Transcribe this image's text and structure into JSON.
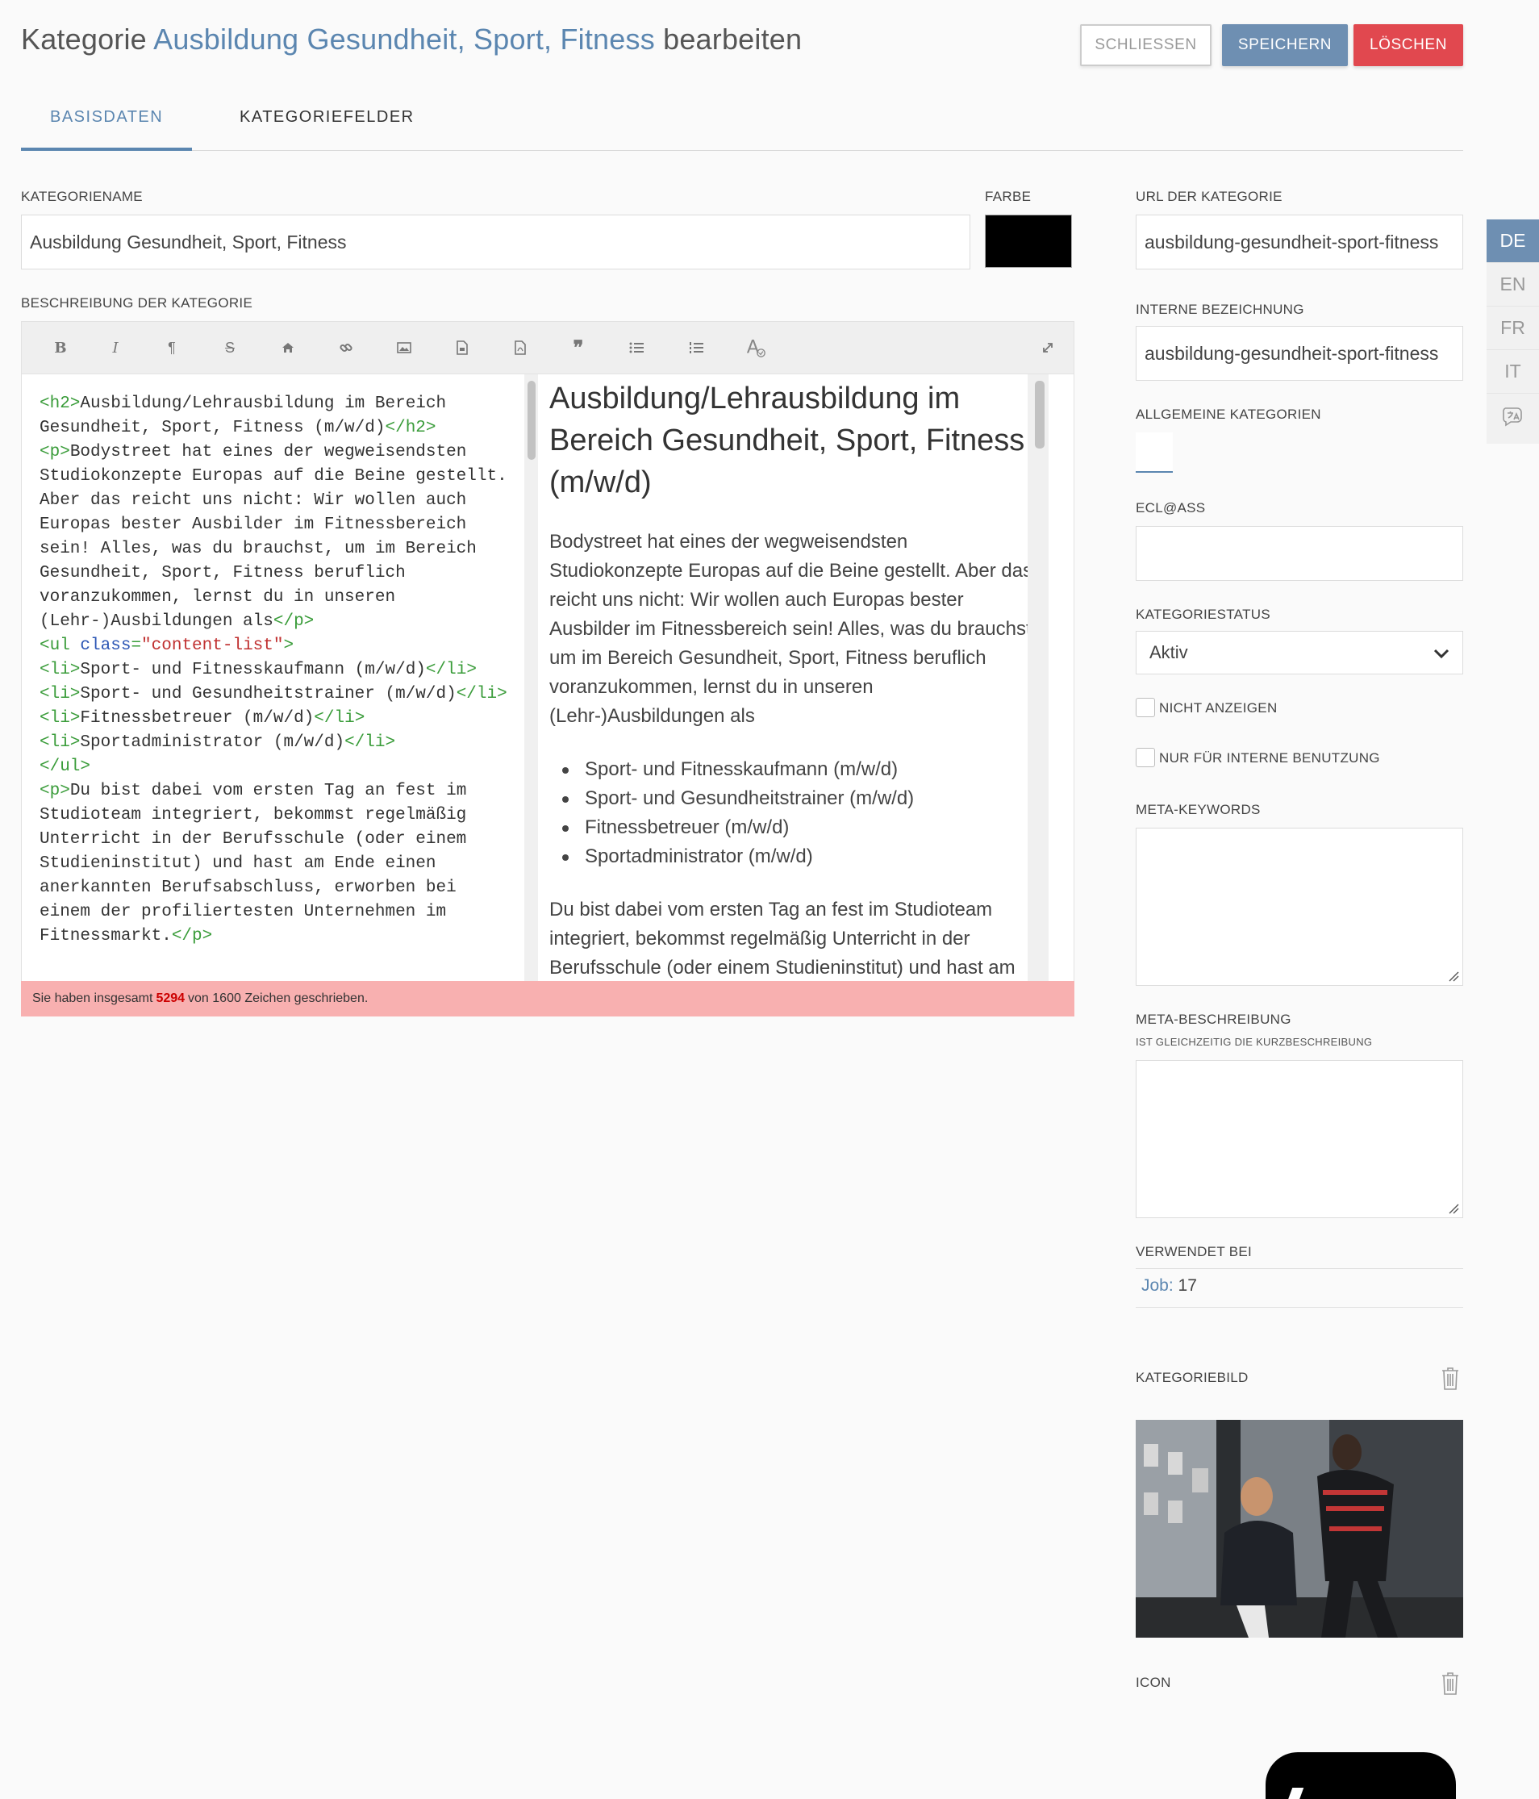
{
  "header": {
    "title_prefix": "Kategorie",
    "title_category": "Ausbildung Gesundheit, Sport, Fitness",
    "title_suffix": "bearbeiten",
    "close_label": "SCHLIESSEN",
    "save_label": "SPEICHERN",
    "delete_label": "LÖSCHEN"
  },
  "tabs": [
    {
      "label": "BASISDATEN",
      "active": true
    },
    {
      "label": "KATEGORIEFELDER",
      "active": false
    }
  ],
  "form": {
    "name_label": "KATEGORIENAME",
    "name_value": "Ausbildung Gesundheit, Sport, Fitness",
    "color_label": "FARBE",
    "color_value": "#000000",
    "description_label": "BESCHREIBUNG DER KATEGORIE",
    "toolbar_icons": [
      "bold-icon",
      "italic-icon",
      "paragraph-icon",
      "strikethrough-icon",
      "home-icon",
      "link-icon",
      "image-icon",
      "file-icon",
      "pdf-icon",
      "quote-icon",
      "unordered-list-icon",
      "ordered-list-icon",
      "spellcheck-icon",
      "fullscreen-icon"
    ],
    "status_prefix": "Sie haben insgesamt",
    "status_count": "5294",
    "status_suffix": "von 1600 Zeichen geschrieben."
  },
  "preview": {
    "heading": "Ausbildung/Lehrausbildung im Bereich Gesundheit, Sport, Fitness (m/w/d)",
    "paragraph1": "Bodystreet hat eines der wegweisendsten Studiokonzepte Europas auf die Beine gestellt. Aber das reicht uns nicht: Wir wollen auch Europas bester Ausbilder im Fitnessbereich sein! Alles, was du brauchst, um im Bereich Gesundheit, Sport, Fitness beruflich voranzukommen, lernst du in unseren (Lehr-)Ausbildungen als",
    "list": [
      "Sport- und Fitnesskaufmann (m/w/d)",
      "Sport- und Gesundheitstrainer (m/w/d)",
      "Fitnessbetreuer (m/w/d)",
      "Sportadministrator (m/w/d)"
    ],
    "paragraph2": "Du bist dabei vom ersten Tag an fest im Studioteam integriert, bekommst regelmäßig Unterricht in der Berufsschule (oder einem Studieninstitut) und hast am Ende einen anerkannten Berufsabschluss, erworben bei einem der profiliertesten Unternehmen im Fitnessmarkt."
  },
  "code": {
    "lines": [
      [
        [
          "tag",
          "<h2>"
        ],
        [
          "text",
          "Ausbildung/Lehrausbildung im Bereich Gesundheit, Sport, Fitness (m/w/d)"
        ],
        [
          "tag",
          "</h2>"
        ]
      ],
      [
        [
          "tag",
          "<p>"
        ],
        [
          "text",
          "Bodystreet hat eines der wegweisendsten Studiokonzepte Europas auf die Beine gestellt. Aber das reicht uns nicht: Wir wollen auch Europas bester Ausbilder im Fitnessbereich sein! Alles, was du brauchst, um im Bereich Gesundheit, Sport, Fitness beruflich voranzukommen, lernst du in unseren (Lehr-)Ausbildungen als"
        ],
        [
          "tag",
          "</p>"
        ]
      ],
      [
        [
          "tag",
          "<ul "
        ],
        [
          "attr",
          "class"
        ],
        [
          "tag",
          "="
        ],
        [
          "str",
          "\"content-list\""
        ],
        [
          "tag",
          ">"
        ]
      ],
      [
        [
          "tag",
          "<li>"
        ],
        [
          "text",
          "Sport- und Fitnesskaufmann (m/w/d)"
        ],
        [
          "tag",
          "</li>"
        ]
      ],
      [
        [
          "tag",
          "<li>"
        ],
        [
          "text",
          "Sport- und Gesundheitstrainer (m/w/d)"
        ],
        [
          "tag",
          "</li>"
        ]
      ],
      [
        [
          "tag",
          "<li>"
        ],
        [
          "text",
          "Fitnessbetreuer (m/w/d)"
        ],
        [
          "tag",
          "</li>"
        ]
      ],
      [
        [
          "tag",
          "<li>"
        ],
        [
          "text",
          "Sportadministrator (m/w/d)"
        ],
        [
          "tag",
          "</li>"
        ]
      ],
      [
        [
          "tag",
          "</ul>"
        ]
      ],
      [
        [
          "tag",
          "<p>"
        ],
        [
          "text",
          "Du bist dabei vom ersten Tag an fest im Studioteam integriert, bekommst regelmäßig Unterricht in der Berufsschule (oder einem Studieninstitut) und hast am Ende einen anerkannten Berufsabschluss, erworben bei einem der profiliertesten Unternehmen im Fitnessmarkt."
        ],
        [
          "tag",
          "</p>"
        ]
      ]
    ]
  },
  "sidebar": {
    "url_label": "URL DER KATEGORIE",
    "url_value": "ausbildung-gesundheit-sport-fitness",
    "internal_label": "INTERNE BEZEICHNUNG",
    "internal_value": "ausbildung-gesundheit-sport-fitness",
    "general_label": "ALLGEMEINE KATEGORIEN",
    "eclass_label": "ECL@ASS",
    "eclass_value": "",
    "status_label": "KATEGORIESTATUS",
    "status_value": "Aktiv",
    "hide_label": "NICHT ANZEIGEN",
    "internal_only_label": "NUR FÜR INTERNE BENUTZUNG",
    "keywords_label": "META-KEYWORDS",
    "meta_desc_label": "META-BESCHREIBUNG",
    "meta_desc_sublabel": "IST GLEICHZEITIG DIE KURZBESCHREIBUNG",
    "used_label": "VERWENDET BEI",
    "used_link": "Job:",
    "used_count": "17",
    "image_label": "KATEGORIEBILD",
    "icon_label": "ICON"
  },
  "languages": [
    {
      "label": "DE",
      "active": true
    },
    {
      "label": "EN",
      "active": false
    },
    {
      "label": "FR",
      "active": false
    },
    {
      "label": "IT",
      "active": false
    }
  ],
  "colors": {
    "accent": "#5b86b0",
    "save": "#6e8fb2",
    "delete": "#e1484f",
    "status_bg": "#f8b0b0"
  }
}
